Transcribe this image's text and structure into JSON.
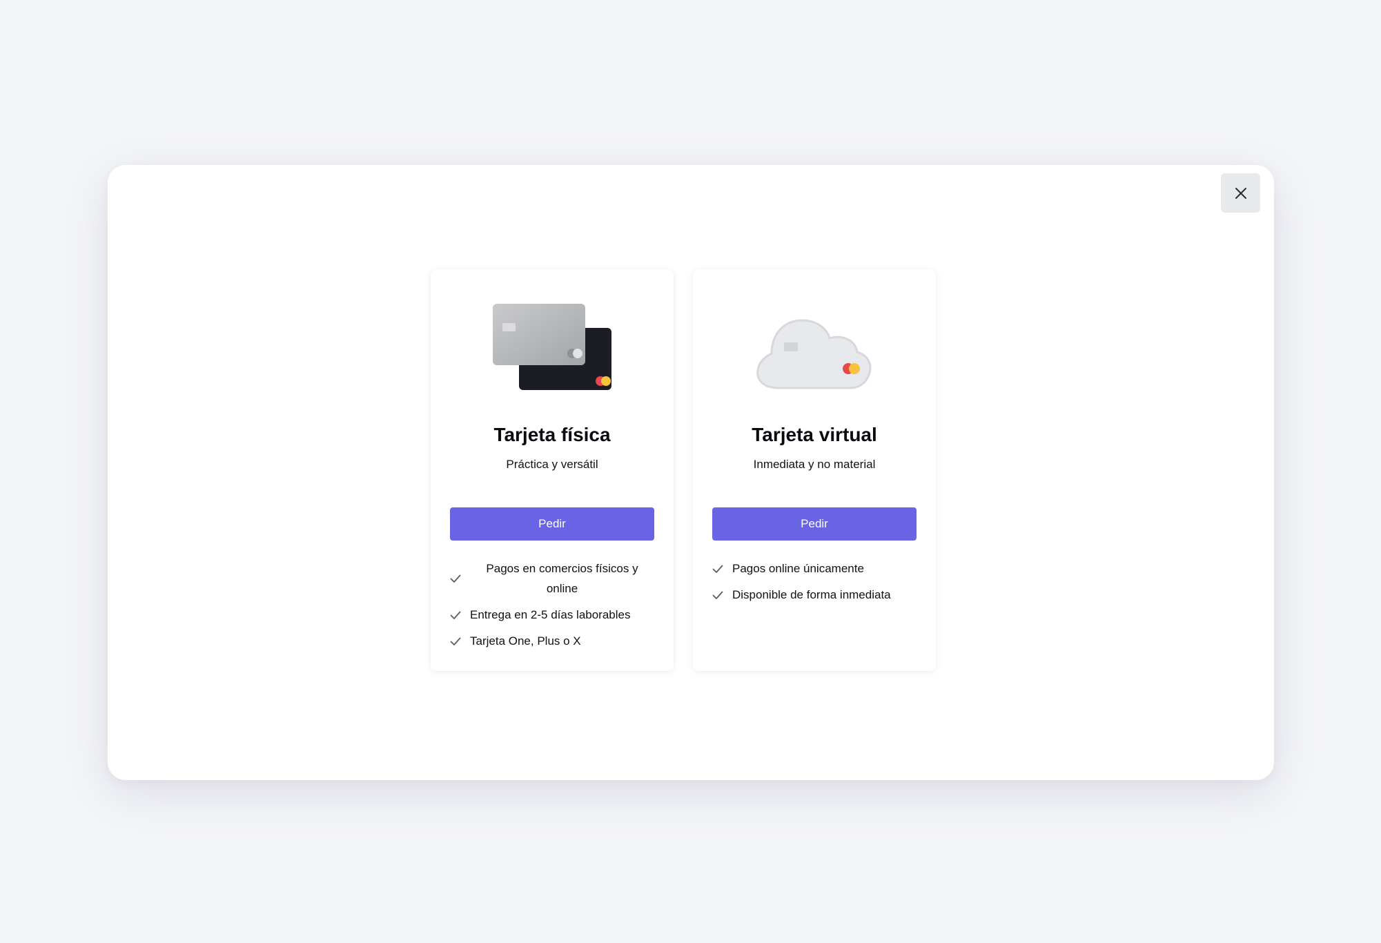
{
  "modal": {
    "close_icon": "close-icon"
  },
  "cards": [
    {
      "title": "Tarjeta física",
      "subtitle": "Práctica y versátil",
      "button_label": "Pedir",
      "illustration": "stacked-cards-illustration",
      "features": [
        "Pagos en comercios físicos y online",
        "Entrega en 2-5 días laborables",
        "Tarjeta One, Plus o X"
      ]
    },
    {
      "title": "Tarjeta virtual",
      "subtitle": "Inmediata y no material",
      "button_label": "Pedir",
      "illustration": "cloud-card-illustration",
      "features": [
        "Pagos online únicamente",
        "Disponible de forma inmediata"
      ]
    }
  ],
  "colors": {
    "page_background": "#f4f5f9",
    "primary_button": "#6864e3",
    "card_dark": "#1b1c24",
    "mastercard_red": "#e5484d",
    "mastercard_yellow": "#f7c23c"
  }
}
